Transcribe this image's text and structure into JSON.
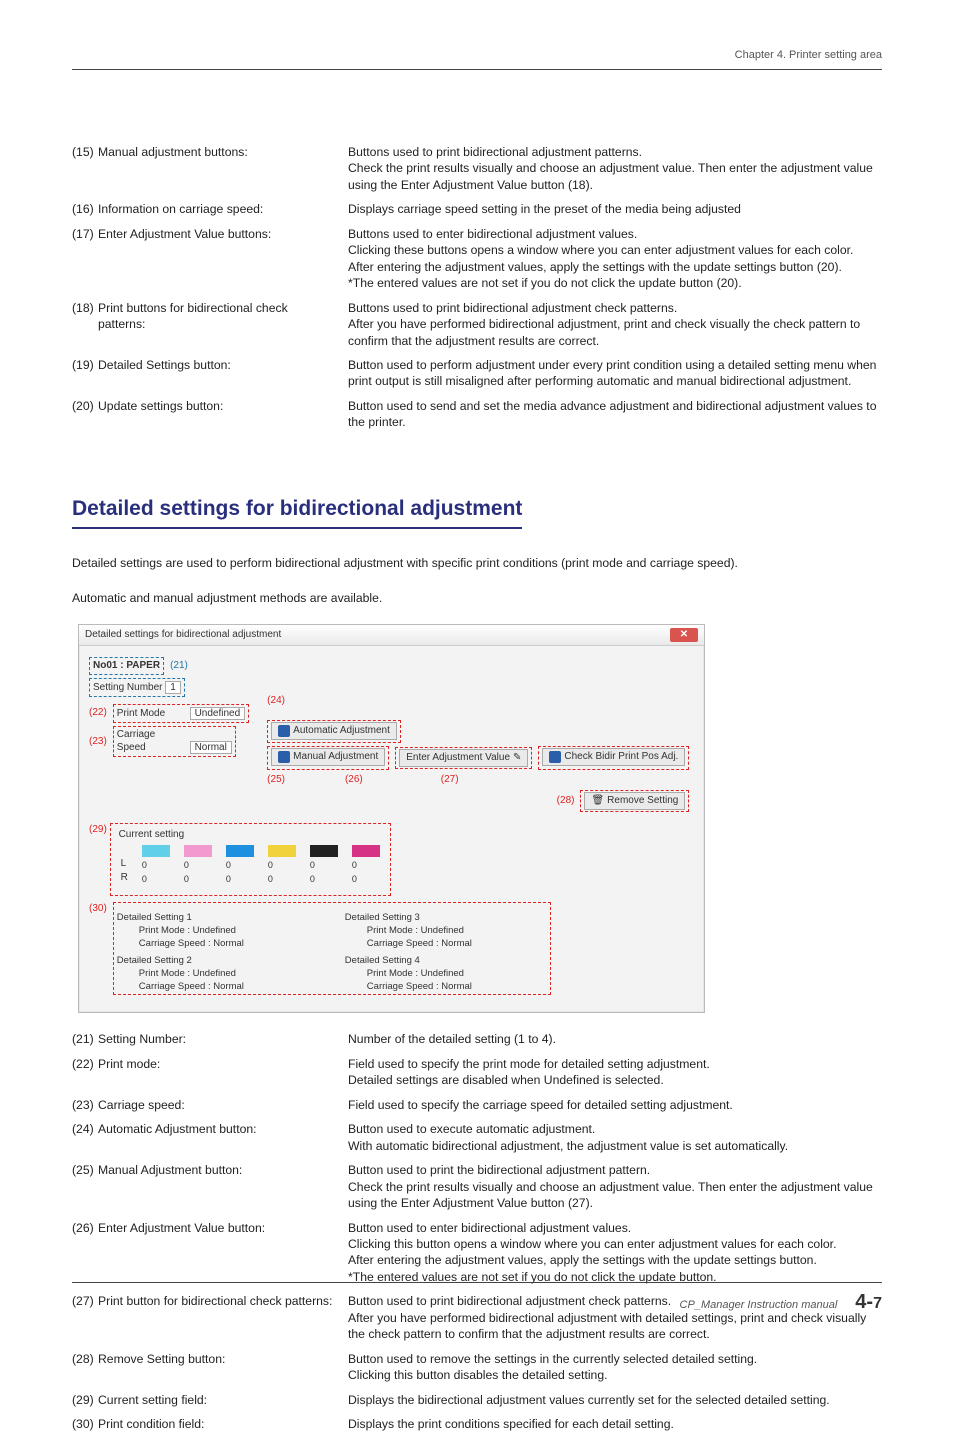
{
  "running_head": "Chapter 4. Printer setting area",
  "defs_top": [
    {
      "n": "(15)",
      "term": "Manual adjustment buttons:",
      "desc": "Buttons used to print bidirectional adjustment patterns.\nCheck the print results visually and choose an adjustment value. Then enter the adjustment value using the Enter Adjustment Value button (18)."
    },
    {
      "n": "(16)",
      "term": "Information on carriage speed:",
      "desc": "Displays carriage speed setting in the preset of the media being adjusted"
    },
    {
      "n": "(17)",
      "term": "Enter Adjustment Value buttons:",
      "desc": "Buttons used to enter bidirectional adjustment values.\nClicking these buttons opens a window where you can enter adjustment values for each color.\nAfter entering the adjustment values, apply the settings with the update settings button (20).\n*The entered values are not set if you do not click the update button (20)."
    },
    {
      "n": "(18)",
      "term": "Print buttons for bidirectional check patterns:",
      "desc": "Buttons used to print bidirectional adjustment check patterns.\nAfter you have performed bidirectional adjustment, print and check visually the check pattern to confirm that the adjustment results are correct."
    },
    {
      "n": "(19)",
      "term": "Detailed Settings button:",
      "desc": "Button used to perform adjustment under every print condition using a detailed setting menu when print output is still misaligned after performing automatic and manual bidirectional adjustment."
    },
    {
      "n": "(20)",
      "term": "Update settings button:",
      "desc": "Button used to send and set the media advance adjustment and bidirectional adjustment values to the printer."
    }
  ],
  "section_title": "Detailed settings for bidirectional adjustment",
  "intro1": "Detailed settings are used to perform bidirectional adjustment with specific print conditions (print mode and carriage speed).",
  "intro2": "Automatic and manual adjustment methods are available.",
  "shot": {
    "title": "Detailed settings for bidirectional adjustment",
    "no_label": "No01 : PAPER",
    "c21": "(21)",
    "setting_number_label": "Setting Number",
    "setting_number_value": "1",
    "c22": "(22)",
    "print_mode_label": "Print Mode",
    "print_mode_value": "Undefined",
    "c23": "(23)",
    "carriage_speed_label": "Carriage Speed",
    "carriage_speed_value": "Normal",
    "c24": "(24)",
    "auto_btn": "Automatic Adjustment",
    "c25": "(25)",
    "manual_btn": "Manual Adjustment",
    "c26": "(26)",
    "enter_btn": "Enter Adjustment Value",
    "c27": "(27)",
    "check_btn": "Check Bidir Print Pos Adj.",
    "c28": "(28)",
    "remove_btn": "Remove Setting",
    "c29": "(29)",
    "currset_label": "Current setting",
    "colors": [
      {
        "name": "LC",
        "hex": "#5fd0e8"
      },
      {
        "name": "LM",
        "hex": "#f29ad0"
      },
      {
        "name": "C",
        "hex": "#1f8fe0"
      },
      {
        "name": "Y",
        "hex": "#f2d23c"
      },
      {
        "name": "K",
        "hex": "#222"
      },
      {
        "name": "M",
        "hex": "#d63384"
      }
    ],
    "L": "L",
    "R": "R",
    "zero": "0",
    "c30": "(30)",
    "ds": [
      {
        "t": "Detailed Setting 1",
        "pm": "Print Mode  :   Undefined",
        "cs": "Carriage Speed :   Normal"
      },
      {
        "t": "Detailed Setting 2",
        "pm": "Print Mode  :   Undefined",
        "cs": "Carriage Speed :   Normal"
      },
      {
        "t": "Detailed Setting 3",
        "pm": "Print Mode  :   Undefined",
        "cs": "Carriage Speed :   Normal"
      },
      {
        "t": "Detailed Setting 4",
        "pm": "Print Mode  :   Undefined",
        "cs": "Carriage Speed :   Normal"
      }
    ]
  },
  "defs_bottom": [
    {
      "n": "(21)",
      "term": "Setting Number:",
      "desc": "Number of the detailed setting (1 to 4)."
    },
    {
      "n": "(22)",
      "term": "Print mode:",
      "desc": "Field used to specify the print mode for detailed setting adjustment.\nDetailed settings are disabled when Undefined is selected."
    },
    {
      "n": "(23)",
      "term": "Carriage speed:",
      "desc": "Field used to specify the carriage speed for detailed setting adjustment."
    },
    {
      "n": "(24)",
      "term": "Automatic Adjustment button:",
      "desc": "Button used to execute automatic adjustment.\nWith automatic bidirectional adjustment, the adjustment value is set automatically."
    },
    {
      "n": "(25)",
      "term": "Manual Adjustment button:",
      "desc": "Button used to print the bidirectional adjustment pattern.\nCheck the print results visually and choose an adjustment value. Then enter the adjustment value using the Enter Adjustment Value button (27)."
    },
    {
      "n": "(26)",
      "term": "Enter Adjustment Value button:",
      "desc": "Button used to enter bidirectional adjustment values.\nClicking this button opens a window where you can enter adjustment values for each color.\nAfter entering the adjustment values, apply the settings with the update settings button.\n *The entered values are not set if you do not click the update button."
    },
    {
      "n": "(27)",
      "term": "Print button for bidirectional check patterns:",
      "desc": "Button used to print bidirectional adjustment check patterns.\nAfter you have performed bidirectional adjustment with detailed settings, print and check visually the check pattern to confirm that the adjustment results are correct."
    },
    {
      "n": "(28)",
      "term": "Remove Setting button:",
      "desc": "Button used to remove the settings in the currently selected detailed setting.\nClicking this button disables the detailed setting."
    },
    {
      "n": "(29)",
      "term": "Current setting field:",
      "desc": "Displays the bidirectional adjustment values currently set for the selected detailed setting."
    },
    {
      "n": "(30)",
      "term": "Print condition field:",
      "desc": "Displays the print conditions specified for each detail setting."
    }
  ],
  "footer_doc": "CP_Manager Instruction manual",
  "footer_page_major": "4-",
  "footer_page_minor": "7"
}
